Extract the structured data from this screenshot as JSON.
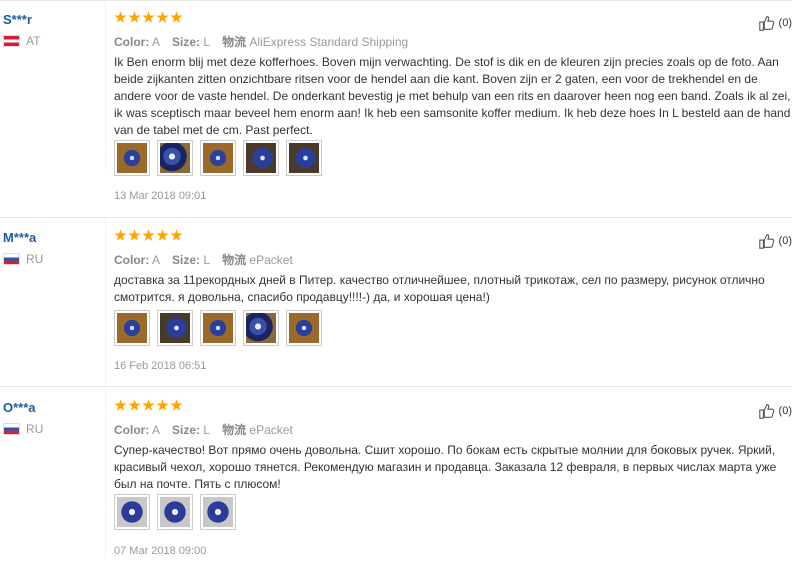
{
  "reviews": [
    {
      "user": "S***r",
      "country": "AT",
      "flag": "austria-flag",
      "stars": 5,
      "color_label": "Color:",
      "color_value": "A",
      "size_label": "Size:",
      "size_value": "L",
      "shipping_label": "物流",
      "shipping_value": "AliExpress Standard Shipping",
      "text": "Ik Ben enorm blij met deze kofferhoes. Boven mijn verwachting. De stof is dik en de kleuren zijn precies zoals op de foto. Aan beide zijkanten zitten onzichtbare ritsen voor de hendel aan die kant. Boven zijn er 2 gaten, een voor de trekhendel en de andere voor de vaste hendel. De onderkant bevestig je met behulp van een rits en daarover heen nog een band. Zoals ik al zei, ik was sceptisch maar beveel hem enorm aan! Ik heb een samsonite koffer medium. Ik heb deze hoes In L besteld aan de hand van de tabel met de cm. Past perfect.",
      "photos": 5,
      "date": "13 Mar 2018 09:01",
      "likes": "(0)"
    },
    {
      "user": "M***a",
      "country": "RU",
      "flag": "russia-flag",
      "stars": 5,
      "color_label": "Color:",
      "color_value": "A",
      "size_label": "Size:",
      "size_value": "L",
      "shipping_label": "物流",
      "shipping_value": "ePacket",
      "text": "доставка за 11рекордных дней в Питер. качество отличнейшее, плотный трикотаж, сел по размеру, рисунок отлично смотрится. я довольна, спасибо продавцу!!!!-) да, и хорошая цена!)",
      "photos": 5,
      "date": "16 Feb 2018 06:51",
      "likes": "(0)"
    },
    {
      "user": "O***a",
      "country": "RU",
      "flag": "russia-flag",
      "stars": 5,
      "color_label": "Color:",
      "color_value": "A",
      "size_label": "Size:",
      "size_value": "L",
      "shipping_label": "物流",
      "shipping_value": "ePacket",
      "text": "Супер-качество! Вот прямо очень довольна. Сшит хорошо. По бокам есть скрытые молнии для боковых ручек. Яркий, красивый чехол, хорошо тянется. Рекомендую магазин и продавца. Заказала 12 февраля, в первых числах марта уже был на почте. Пять с плюсом!",
      "photos": 3,
      "date": "07 Mar 2018 09:00",
      "likes": "(0)"
    }
  ],
  "colors": {
    "star": "#ffa500",
    "username": "#1f5aa8",
    "muted": "#999999"
  }
}
